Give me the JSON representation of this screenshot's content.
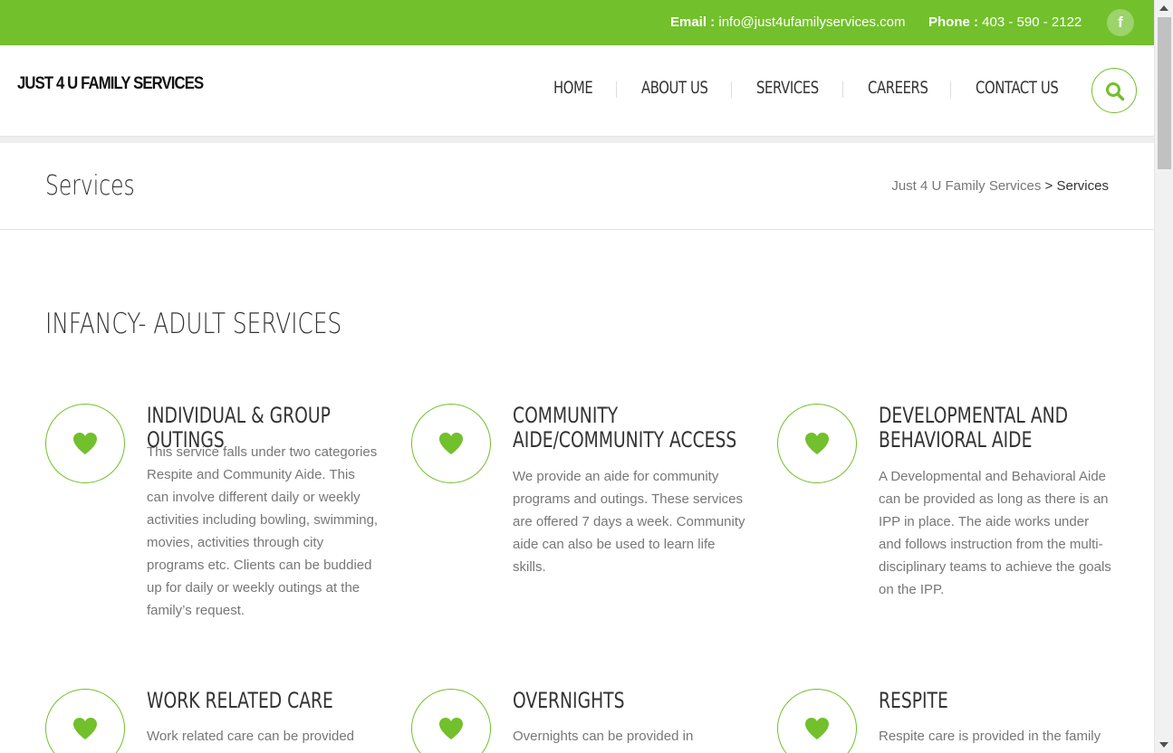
{
  "topbar": {
    "email_label": "Email :",
    "email_value": "info@just4ufamilyservices.com",
    "phone_label": "Phone :",
    "phone_value": "403 - 590 - 2122",
    "facebook_glyph": "f"
  },
  "header": {
    "logo": "JUST 4 U FAMILY SERVICES",
    "nav": [
      "HOME",
      "ABOUT US",
      "SERVICES",
      "CAREERS",
      "CONTACT US"
    ]
  },
  "breadcrumbs": {
    "title": "Services",
    "link": "Just 4 U Family Services",
    "separator": ">",
    "current": "Services"
  },
  "main": {
    "section_title": "INFANCY- ADULT SERVICES",
    "services": [
      {
        "title": "INDIVIDUAL & GROUP OUTINGS",
        "desc": "This service falls under two categories Respite and Community Aide. This can involve different daily or weekly activities including bowling, swimming, movies, activities through city programs etc. Clients can be buddied up for daily or weekly outings at the family’s request."
      },
      {
        "title": "COMMUNITY AIDE/COMMUNITY ACCESS",
        "desc": "We provide an aide for community programs and outings. These services are offered 7 days a week. Community aide can also be used to learn life skills."
      },
      {
        "title": "DEVELOPMENTAL AND BEHAVIORAL AIDE",
        "desc": "A Developmental and  Behavioral Aide can be provided as long as there is an IPP in place. The aide works under and follows instruction from the multi-disciplinary teams to achieve the goals on the IPP."
      },
      {
        "title": "WORK RELATED CARE",
        "desc": "Work related care can be provided"
      },
      {
        "title": "OVERNIGHTS",
        "desc": "Overnights can be provided in"
      },
      {
        "title": "RESPITE",
        "desc": "Respite care is provided in the family"
      }
    ]
  },
  "icons": {
    "service_icon": "heart-icon",
    "search": "search-icon",
    "facebook": "facebook-icon"
  },
  "colors": {
    "accent": "#72c02c"
  }
}
